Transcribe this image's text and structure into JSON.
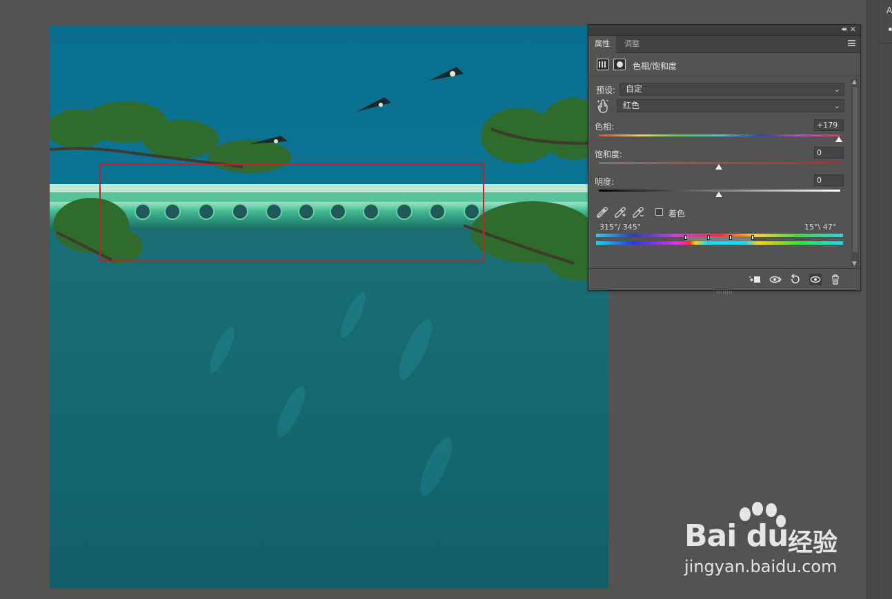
{
  "panel": {
    "tabs": [
      "属性",
      "调整"
    ],
    "adjustment_title": "色相/饱和度",
    "preset_label": "预设:",
    "preset_value": "自定",
    "channel_value": "红色",
    "hue": {
      "label": "色相:",
      "value": "+179",
      "fraction": 1.0
    },
    "saturation": {
      "label": "饱和度:",
      "value": "0",
      "fraction": 0.5
    },
    "lightness": {
      "label": "明度:",
      "value": "0",
      "fraction": 0.5
    },
    "colorize_label": "着色",
    "range_left": "315°/ 345°",
    "range_right": "15°\\ 47°"
  },
  "watermark": {
    "brand": "Bai du",
    "brand_cn": "经验",
    "url": "jingyan.baidu.com"
  },
  "colors": {
    "selection_rect": "#c0242a",
    "panel_bg": "#535353",
    "sky": "#0a6f8f"
  }
}
